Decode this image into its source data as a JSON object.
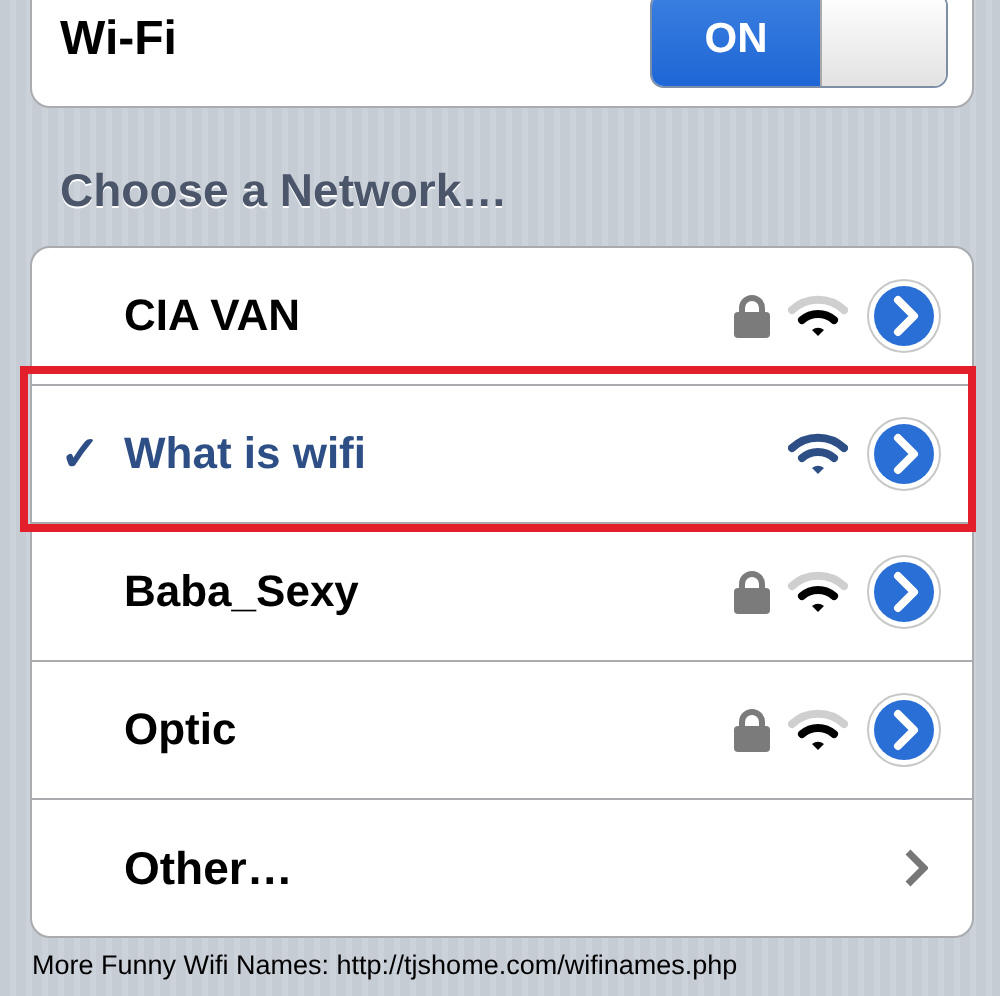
{
  "wifi": {
    "label": "Wi-Fi",
    "on": true,
    "toggle_label": "ON"
  },
  "section_title": "Choose a Network…",
  "networks": [
    {
      "name": "CIA VAN",
      "selected": false,
      "locked": true,
      "highlighted": false
    },
    {
      "name": "What is wifi",
      "selected": true,
      "locked": false,
      "highlighted": true,
      "check": "✓"
    },
    {
      "name": "Baba_Sexy",
      "selected": false,
      "locked": true,
      "highlighted": false
    },
    {
      "name": "Optic",
      "selected": false,
      "locked": true,
      "highlighted": false
    }
  ],
  "other": {
    "label": "Other…"
  },
  "caption": "More Funny Wifi Names: http://tjshome.com/wifinames.php"
}
